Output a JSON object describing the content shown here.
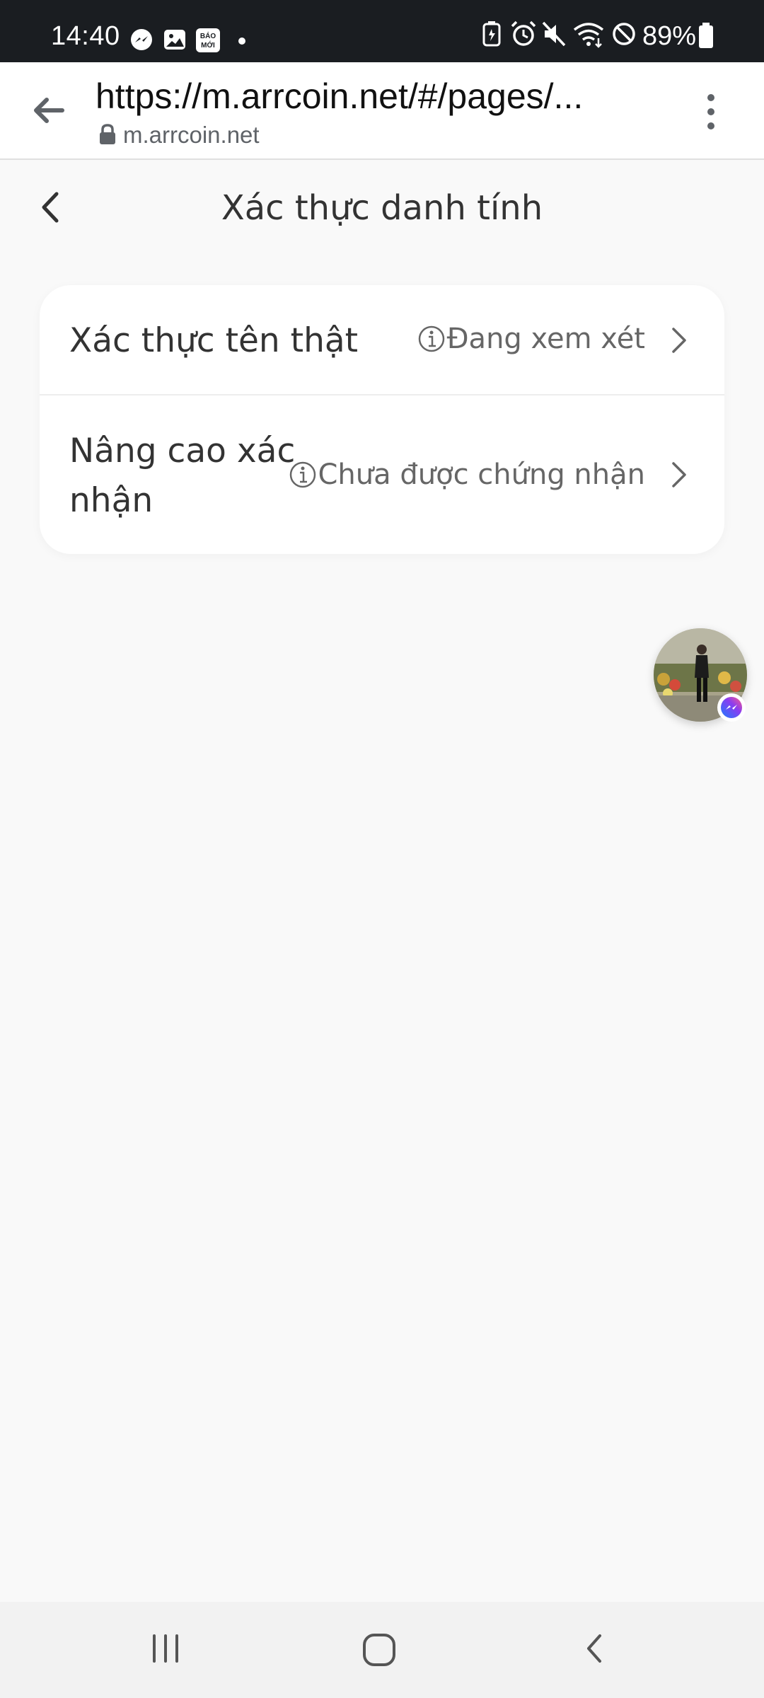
{
  "status_bar": {
    "time": "14:40",
    "left_icons": [
      "messenger-icon",
      "gallery-icon",
      "baomoi-icon",
      "dot-icon"
    ],
    "baomoi_text": "BÁO MỚI",
    "right_icons": [
      "battery-saver-icon",
      "alarm-icon",
      "mute-icon",
      "wifi-icon",
      "dnd-icon",
      "battery-icon"
    ],
    "battery": "89%"
  },
  "browser": {
    "url": "https://m.arrcoin.net/#/pages/...",
    "domain": "m.arrcoin.net"
  },
  "page": {
    "title": "Xác thực danh tính"
  },
  "verification": {
    "items": [
      {
        "label": "Xác thực tên thật",
        "status": "Đang xem xét"
      },
      {
        "label": "Nâng cao xác nhận",
        "status": "Chưa được chứng nhận"
      }
    ]
  },
  "colors": {
    "status_bar_bg": "#1a1d21",
    "page_bg": "#f9f9f9",
    "card_bg": "#ffffff",
    "text_primary": "#333333",
    "text_secondary": "#666666",
    "messenger_accent": "#7b3ff2"
  }
}
